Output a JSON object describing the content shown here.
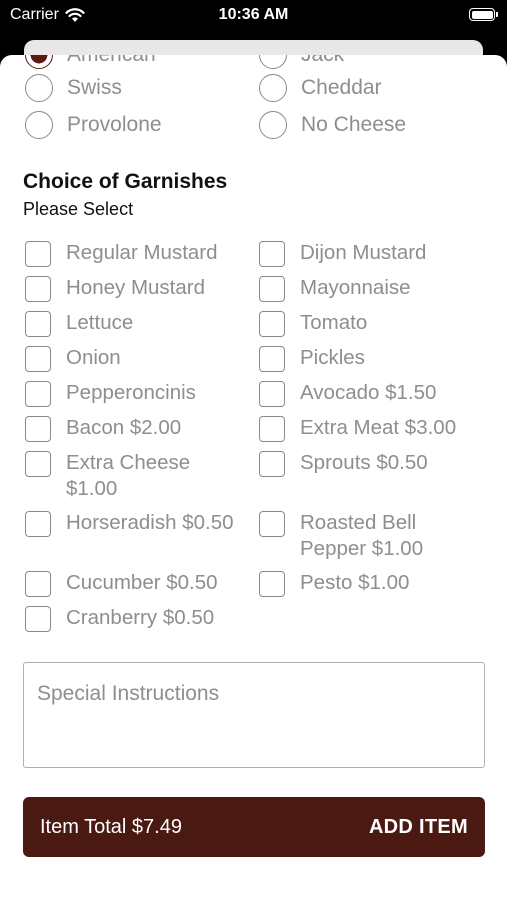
{
  "status_bar": {
    "carrier": "Carrier",
    "time": "10:36 AM"
  },
  "cheese": {
    "partial": [
      "American",
      "Jack"
    ],
    "options": [
      "Swiss",
      "Cheddar",
      "Provolone",
      "No Cheese"
    ]
  },
  "garnishes": {
    "title": "Choice of Garnishes",
    "subtitle": "Please Select",
    "items": [
      "Regular Mustard",
      "Dijon Mustard",
      "Honey Mustard",
      "Mayonnaise",
      "Lettuce",
      "Tomato",
      "Onion",
      "Pickles",
      "Pepperoncinis",
      "Avocado $1.50",
      "Bacon $2.00",
      "Extra Meat $3.00",
      "Extra Cheese $1.00",
      "Sprouts $0.50",
      "Horseradish $0.50",
      "Roasted Bell Pepper $1.00",
      "Cucumber $0.50",
      "Pesto $1.00",
      "Cranberry $0.50"
    ]
  },
  "special_instructions": {
    "placeholder": "Special Instructions"
  },
  "footer": {
    "total": "Item Total $7.49",
    "add_label": "ADD ITEM"
  }
}
